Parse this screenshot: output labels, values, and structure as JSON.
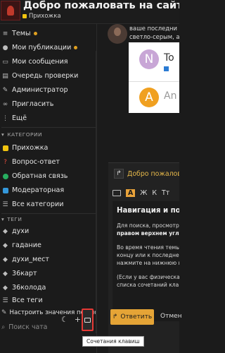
{
  "header": {
    "title": "Добро пожаловать на сайт Ча",
    "subcategory": "Прихожка"
  },
  "sidebar": {
    "items": [
      {
        "label": "Темы",
        "icon": "layers-icon",
        "dot": true
      },
      {
        "label": "Мои публикации",
        "icon": "user-icon",
        "dot": true
      },
      {
        "label": "Мои сообщения",
        "icon": "inbox-icon",
        "dot": false
      },
      {
        "label": "Очередь проверки",
        "icon": "queue-icon",
        "dot": false
      },
      {
        "label": "Администратор",
        "icon": "wrench-icon",
        "dot": false
      },
      {
        "label": "Пригласить",
        "icon": "link-icon",
        "dot": false
      },
      {
        "label": "Ещё",
        "icon": "more-icon",
        "dot": false
      }
    ],
    "categories_heading": "КАТЕГОРИИ",
    "categories": [
      {
        "label": "Прихожка",
        "color": "#f1c40f"
      },
      {
        "label": "Вопрос-ответ",
        "color": "#e74c3c"
      },
      {
        "label": "Обратная связь",
        "color": "#27ae60"
      },
      {
        "label": "Модераторная",
        "color": "#3498db"
      }
    ],
    "all_categories": "Все категории",
    "tags_heading": "ТЕГИ",
    "tags": [
      "духи",
      "гадание",
      "духи_мест",
      "36карт",
      "36колода"
    ],
    "all_tags": "Все теги",
    "configure_defaults": "Настроить значения по умол",
    "search_chat_placeholder": "Поиск чата"
  },
  "post": {
    "text_lines": [
      "ваше последни",
      "светло-серым, а"
    ],
    "card": [
      {
        "letter": "N",
        "text": "To",
        "avatar_color": "#c8a6d6"
      },
      {
        "letter": "A",
        "text": "An",
        "avatar_color": "#f0a020"
      }
    ]
  },
  "composer": {
    "reply_title": "Добро пожаловать",
    "toolbar": [
      "A",
      "Ж",
      "К",
      "Tт"
    ],
    "heading": "Навигация и пои",
    "paragraph1": [
      "Для поиска, просмотр",
      "правом верхнем углу"
    ],
    "paragraph2": [
      "Во время чтения темы",
      "концу или к последнем",
      "нажмите на нижнюю п"
    ],
    "paragraph3": [
      "(Если у вас физическа",
      "списка сочетаний кла"
    ],
    "answer_button": "Ответить",
    "cancel_button": "Отмен"
  },
  "tooltip": "Сочетания клавиш"
}
